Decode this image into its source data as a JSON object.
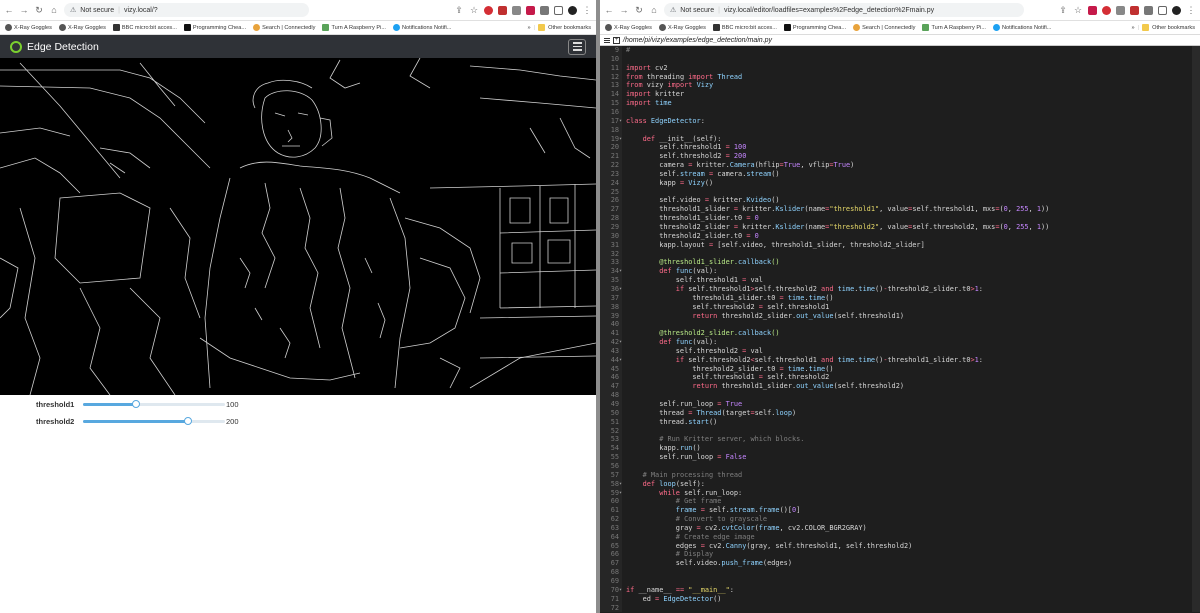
{
  "left_browser": {
    "security_label": "Not secure",
    "url": "vizy.local/?",
    "bookmarks": [
      "X-Ray Goggles",
      "X-Ray Goggles",
      "BBC micro:bit acces...",
      "Programming Chea...",
      "Search | Connectedly",
      "Turn A Raspberry Pi...",
      "Notifications Notifi..."
    ],
    "bookmark_more": "»",
    "other_bookmarks": "Other bookmarks"
  },
  "app": {
    "title": "Edge Detection",
    "sliders": [
      {
        "label": "threshold1",
        "value": "100",
        "fraction": 0.37
      },
      {
        "label": "threshold2",
        "value": "200",
        "fraction": 0.74
      }
    ]
  },
  "right_browser": {
    "security_label": "Not secure",
    "url": "vizy.local/editor/loadfiles=examples%2Fedge_detection%2Fmain.py",
    "bookmarks": [
      "X-Ray Goggles",
      "X-Ray Goggles",
      "BBC micro:bit acces...",
      "Programming Chea...",
      "Search | Connectedly",
      "Turn A Raspberry Pi...",
      "Notifications Notifi..."
    ],
    "bookmark_more": "»",
    "other_bookmarks": "Other bookmarks"
  },
  "editor": {
    "file_path": "/home/pi/vizy/examples/edge_detection/main.py",
    "lines": [
      {
        "n": "9",
        "t": "#"
      },
      {
        "n": "10",
        "t": ""
      },
      {
        "n": "11",
        "t": "import cv2"
      },
      {
        "n": "12",
        "t": "from threading import Thread"
      },
      {
        "n": "13",
        "t": "from vizy import Vizy"
      },
      {
        "n": "14",
        "t": "import kritter"
      },
      {
        "n": "15",
        "t": "import time"
      },
      {
        "n": "16",
        "t": ""
      },
      {
        "n": "17",
        "t": "class EdgeDetector:"
      },
      {
        "n": "18",
        "t": ""
      },
      {
        "n": "19",
        "t": "    def __init__(self):"
      },
      {
        "n": "20",
        "t": "        self.threshold1 = 100"
      },
      {
        "n": "21",
        "t": "        self.threshold2 = 200"
      },
      {
        "n": "22",
        "t": "        camera = kritter.Camera(hflip=True, vflip=True)"
      },
      {
        "n": "23",
        "t": "        self.stream = camera.stream()"
      },
      {
        "n": "24",
        "t": "        kapp = Vizy()"
      },
      {
        "n": "25",
        "t": ""
      },
      {
        "n": "26",
        "t": "        self.video = kritter.Kvideo()"
      },
      {
        "n": "27",
        "t": "        threshold1_slider = kritter.Kslider(name=\"threshold1\", value=self.threshold1, mxs=(0, 255, 1))"
      },
      {
        "n": "28",
        "t": "        threshold1_slider.t0 = 0"
      },
      {
        "n": "29",
        "t": "        threshold2_slider = kritter.Kslider(name=\"threshold2\", value=self.threshold2, mxs=(0, 255, 1))"
      },
      {
        "n": "30",
        "t": "        threshold2_slider.t0 = 0"
      },
      {
        "n": "31",
        "t": "        kapp.layout = [self.video, threshold1_slider, threshold2_slider]"
      },
      {
        "n": "32",
        "t": ""
      },
      {
        "n": "33",
        "t": "        @threshold1_slider.callback()"
      },
      {
        "n": "34",
        "t": "        def func(val):"
      },
      {
        "n": "35",
        "t": "            self.threshold1 = val"
      },
      {
        "n": "36",
        "t": "            if self.threshold1>self.threshold2 and time.time()-threshold2_slider.t0>1:"
      },
      {
        "n": "37",
        "t": "                threshold1_slider.t0 = time.time()"
      },
      {
        "n": "38",
        "t": "                self.threshold2 = self.threshold1"
      },
      {
        "n": "39",
        "t": "                return threshold2_slider.out_value(self.threshold1)"
      },
      {
        "n": "40",
        "t": ""
      },
      {
        "n": "41",
        "t": "        @threshold2_slider.callback()"
      },
      {
        "n": "42",
        "t": "        def func(val):"
      },
      {
        "n": "43",
        "t": "            self.threshold2 = val"
      },
      {
        "n": "44",
        "t": "            if self.threshold2<self.threshold1 and time.time()-threshold1_slider.t0>1:"
      },
      {
        "n": "45",
        "t": "                threshold2_slider.t0 = time.time()"
      },
      {
        "n": "46",
        "t": "                self.threshold1 = self.threshold2"
      },
      {
        "n": "47",
        "t": "                return threshold1_slider.out_value(self.threshold2)"
      },
      {
        "n": "48",
        "t": ""
      },
      {
        "n": "49",
        "t": "        self.run_loop = True"
      },
      {
        "n": "50",
        "t": "        thread = Thread(target=self.loop)"
      },
      {
        "n": "51",
        "t": "        thread.start()"
      },
      {
        "n": "52",
        "t": ""
      },
      {
        "n": "53",
        "t": "        # Run Kritter server, which blocks."
      },
      {
        "n": "54",
        "t": "        kapp.run()"
      },
      {
        "n": "55",
        "t": "        self.run_loop = False"
      },
      {
        "n": "56",
        "t": ""
      },
      {
        "n": "57",
        "t": "    # Main processing thread"
      },
      {
        "n": "58",
        "t": "    def loop(self):"
      },
      {
        "n": "59",
        "t": "        while self.run_loop:"
      },
      {
        "n": "60",
        "t": "            # Get frame"
      },
      {
        "n": "61",
        "t": "            frame = self.stream.frame()[0]"
      },
      {
        "n": "62",
        "t": "            # Convert to grayscale"
      },
      {
        "n": "63",
        "t": "            gray = cv2.cvtColor(frame, cv2.COLOR_BGR2GRAY)"
      },
      {
        "n": "64",
        "t": "            # Create edge image"
      },
      {
        "n": "65",
        "t": "            edges = cv2.Canny(gray, self.threshold1, self.threshold2)"
      },
      {
        "n": "66",
        "t": "            # Display"
      },
      {
        "n": "67",
        "t": "            self.video.push_frame(edges)"
      },
      {
        "n": "68",
        "t": ""
      },
      {
        "n": "69",
        "t": ""
      },
      {
        "n": "70",
        "t": "if __name__ == \"__main__\":"
      },
      {
        "n": "71",
        "t": "    ed = EdgeDetector()"
      },
      {
        "n": "72",
        "t": ""
      }
    ]
  },
  "colors": {
    "accent": "#58a8df",
    "appbar": "#2f3237",
    "logo_ring": "#7bd02f",
    "editor_bg": "#1e1e1e"
  }
}
